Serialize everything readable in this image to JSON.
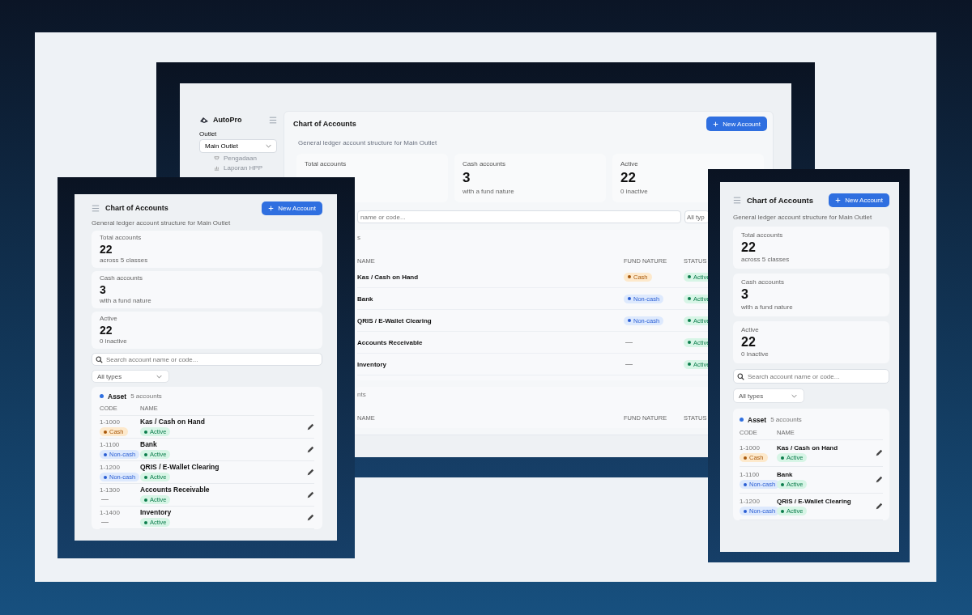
{
  "desktop": {
    "sidebar": {
      "brand": "AutoPro",
      "outlet_label": "Outlet",
      "outlet_select": "Main Outlet",
      "nav_items": [
        "Pengadaan",
        "Laporan HPP"
      ]
    },
    "title": "Chart of Accounts",
    "new_button": "New Account",
    "subtitle": "General ledger account structure for Main Outlet",
    "stats": [
      {
        "label": "Total accounts"
      },
      {
        "label": "Cash accounts",
        "value": "3",
        "note": "with a fund nature"
      },
      {
        "label": "Active",
        "value": "22",
        "note": "0 inactive"
      }
    ],
    "search": {
      "placeholder": "name or code..."
    },
    "type_filter": "All typ",
    "groups": [
      {
        "count": "s",
        "columns": [
          "NAME",
          "FUND NATURE",
          "STATUS"
        ],
        "rows": [
          {
            "name": "Kas / Cash on Hand",
            "fund": {
              "label": "Cash",
              "kind": "cash"
            },
            "status": "Active"
          },
          {
            "name": "Bank",
            "fund": {
              "label": "Non-cash",
              "kind": "noncash"
            },
            "status": "Active"
          },
          {
            "name": "QRIS / E-Wallet Clearing",
            "fund": {
              "label": "Non-cash",
              "kind": "noncash"
            },
            "status": "Active"
          },
          {
            "name": "Accounts Receivable",
            "fund": {
              "label": "—",
              "kind": "none"
            },
            "status": "Active"
          },
          {
            "name": "Inventory",
            "fund": {
              "label": "—",
              "kind": "none"
            },
            "status": "Active"
          }
        ]
      },
      {
        "count": "nts",
        "columns": [
          "NAME",
          "FUND NATURE",
          "STATUS"
        ]
      }
    ]
  },
  "phone_left": {
    "title": "Chart of Accounts",
    "new_button": "New Account",
    "subtitle": "General ledger account structure for Main Outlet",
    "stats": [
      {
        "label": "Total accounts",
        "value": "22",
        "note": "across 5 classes"
      },
      {
        "label": "Cash accounts",
        "value": "3",
        "note": "with a fund nature"
      },
      {
        "label": "Active",
        "value": "22",
        "note": "0 inactive"
      }
    ],
    "search": {
      "placeholder": "Search account name or code..."
    },
    "type_filter": "All types",
    "group": {
      "name": "Asset",
      "count": "5 accounts",
      "columns": [
        "CODE",
        "NAME"
      ],
      "rows": [
        {
          "code": "1-1000",
          "fund": {
            "label": "Cash",
            "kind": "cash"
          },
          "name": "Kas / Cash on Hand",
          "status": "Active"
        },
        {
          "code": "1-1100",
          "fund": {
            "label": "Non-cash",
            "kind": "noncash"
          },
          "name": "Bank",
          "status": "Active"
        },
        {
          "code": "1-1200",
          "fund": {
            "label": "Non-cash",
            "kind": "noncash"
          },
          "name": "QRIS / E-Wallet Clearing",
          "status": "Active"
        },
        {
          "code": "1-1300",
          "fund": {
            "label": "—",
            "kind": "none"
          },
          "name": "Accounts Receivable",
          "status": "Active"
        },
        {
          "code": "1-1400",
          "fund": {
            "label": "—",
            "kind": "none"
          },
          "name": "Inventory",
          "status": "Active"
        }
      ]
    }
  },
  "phone_right": {
    "title": "Chart of Accounts",
    "new_button": "New Account",
    "subtitle": "General ledger account structure for Main Outlet",
    "stats": [
      {
        "label": "Total accounts",
        "value": "22",
        "note": "across 5 classes"
      },
      {
        "label": "Cash accounts",
        "value": "3",
        "note": "with a fund nature"
      },
      {
        "label": "Active",
        "value": "22",
        "note": "0 inactive"
      }
    ],
    "search": {
      "placeholder": "Search account name or code..."
    },
    "type_filter": "All types",
    "group": {
      "name": "Asset",
      "count": "5 accounts",
      "columns": [
        "CODE",
        "NAME"
      ],
      "rows": [
        {
          "code": "1-1000",
          "fund": {
            "label": "Cash",
            "kind": "cash"
          },
          "name": "Kas / Cash on Hand",
          "status": "Active"
        },
        {
          "code": "1-1100",
          "fund": {
            "label": "Non-cash",
            "kind": "noncash"
          },
          "name": "Bank",
          "status": "Active"
        },
        {
          "code": "1-1200",
          "fund": {
            "label": "Non-cash",
            "kind": "noncash"
          },
          "name": "QRIS / E-Wallet Clearing",
          "status": "Active"
        }
      ]
    }
  }
}
